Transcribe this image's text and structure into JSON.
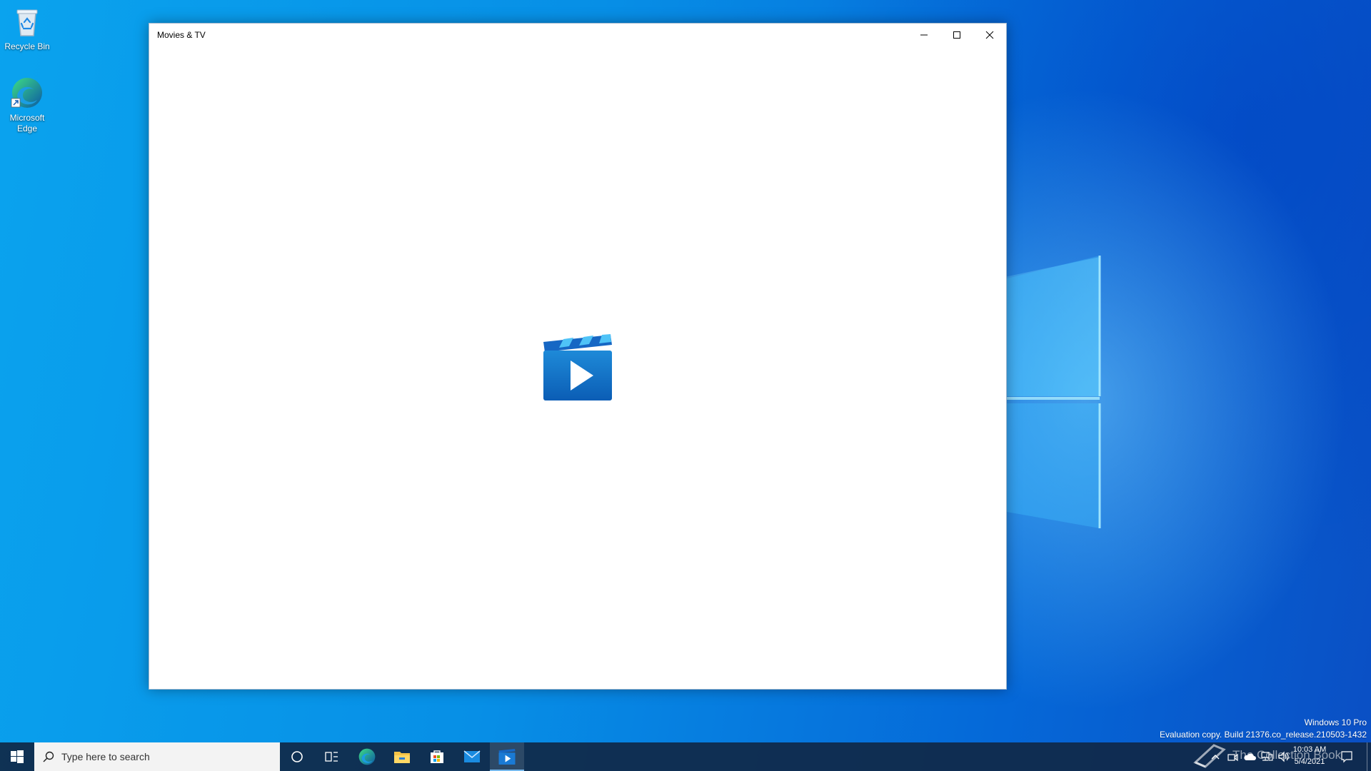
{
  "desktop": {
    "icons": [
      {
        "label": "Recycle Bin",
        "icon": "recycle-bin-icon"
      },
      {
        "label": "Microsoft Edge",
        "icon": "edge-icon"
      }
    ]
  },
  "window": {
    "title": "Movies & TV",
    "controls": [
      "minimize-icon",
      "maximize-icon",
      "close-icon"
    ],
    "splash_icon": "movies-tv-logo-icon"
  },
  "taskbar": {
    "search_placeholder": "Type here to search",
    "pinned": [
      {
        "name": "cortana",
        "icon": "circle-icon"
      },
      {
        "name": "task-view",
        "icon": "task-view-icon"
      },
      {
        "name": "edge",
        "icon": "edge-icon"
      },
      {
        "name": "file-explorer",
        "icon": "folder-icon"
      },
      {
        "name": "microsoft-store",
        "icon": "store-icon"
      },
      {
        "name": "mail",
        "icon": "mail-icon"
      },
      {
        "name": "movies-tv",
        "icon": "movies-tv-icon",
        "active": true
      }
    ],
    "clock_time": "10:03 AM",
    "clock_date": "5/4/2021"
  },
  "watermark": {
    "line1": "Windows 10 Pro",
    "line2": "Evaluation copy. Build 21376.co_release.210503-1432"
  },
  "overlay_text": "The Collection Book",
  "colors": {
    "taskbar": "#10284a",
    "accent": "#0a78d7",
    "desktop": "#0a8fe6"
  }
}
